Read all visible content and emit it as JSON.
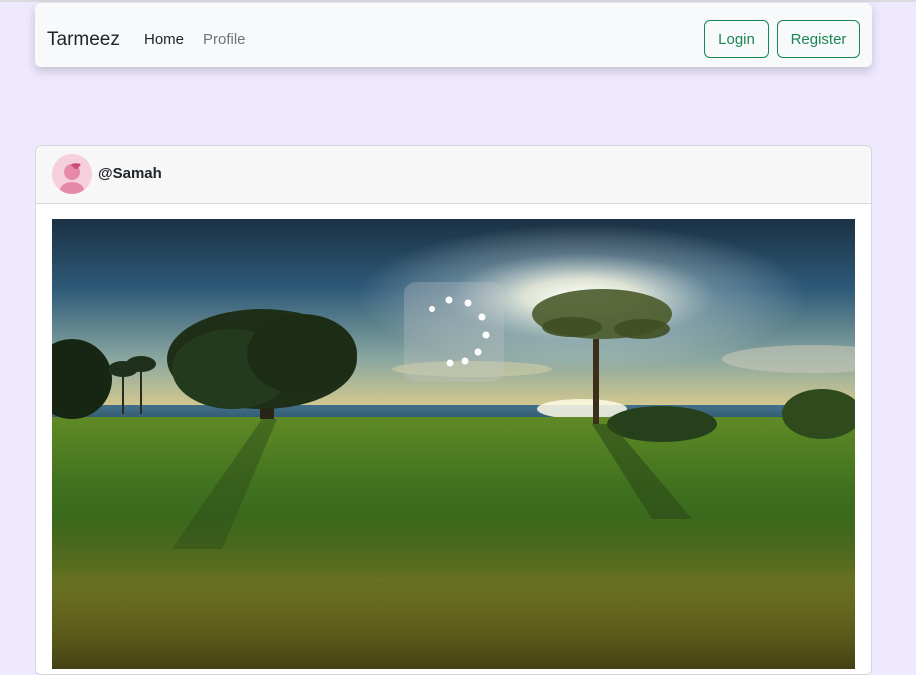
{
  "navbar": {
    "brand": "Tarmeez",
    "links": [
      {
        "label": "Home"
      },
      {
        "label": "Profile"
      }
    ],
    "login_label": "Login",
    "register_label": "Register",
    "accent_color": "#198754"
  },
  "post": {
    "username": "@Samah",
    "avatar_icon": "user-avatar-icon",
    "image_icon": "landscape-photo"
  },
  "loader": {
    "icon": "spinner-icon"
  }
}
